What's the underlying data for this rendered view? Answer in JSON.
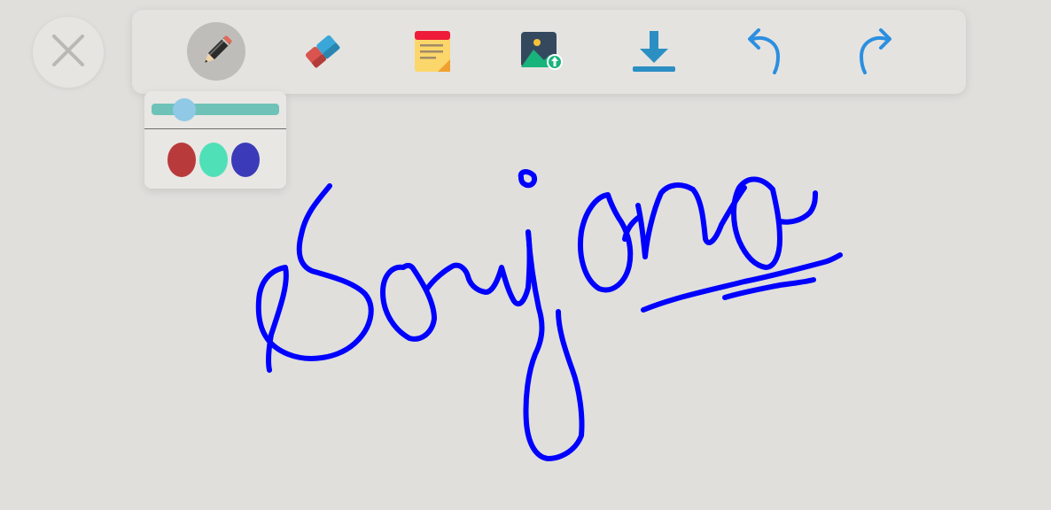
{
  "close_button": {
    "icon": "close-icon",
    "color": "#b9b8b5"
  },
  "toolbar": {
    "tools": [
      {
        "name": "pencil",
        "icon": "pencil-icon",
        "active": true
      },
      {
        "name": "eraser",
        "icon": "eraser-icon",
        "active": false
      },
      {
        "name": "sticky-note",
        "icon": "sticky-note-icon",
        "active": false
      },
      {
        "name": "image-upload",
        "icon": "image-upload-icon",
        "active": false
      },
      {
        "name": "download",
        "icon": "download-icon",
        "active": false
      },
      {
        "name": "undo",
        "icon": "undo-icon",
        "active": false
      },
      {
        "name": "redo",
        "icon": "redo-icon",
        "active": false
      }
    ]
  },
  "pen_panel": {
    "stroke_size_level": 0.2,
    "colors": [
      "#b93a3a",
      "#4fe0b8",
      "#3b3bb9"
    ]
  },
  "drawing": {
    "stroke_color": "#0000ff"
  }
}
